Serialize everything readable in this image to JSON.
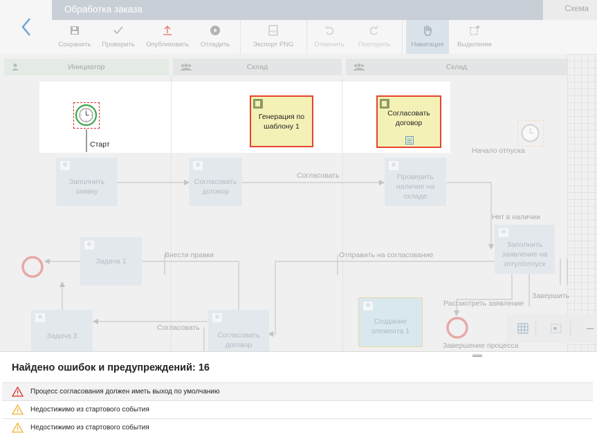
{
  "header": {
    "title": "Обработка заказа",
    "mode": "Схема"
  },
  "toolbar": {
    "save": "Сохранить",
    "check": "Проверить",
    "publish": "Опубликовать",
    "debug": "Отладить",
    "export_png": "Экспорт PNG",
    "undo": "Отменить",
    "redo": "Повторить",
    "navigation": "Навигация",
    "selection": "Выделение"
  },
  "lanes": [
    {
      "title": "Инициатор"
    },
    {
      "title": "Склад"
    },
    {
      "title": "Склад"
    }
  ],
  "diagram": {
    "start_label": "Старт",
    "task_generate": "Генерация по шаблону 1",
    "task_approve_contract": "Согласовать договор",
    "event_vacation_start": "Начало отпуска",
    "task_fill_request": "Заполнить заявку",
    "task_approve_contract_2": "Согласовать договор",
    "flow_approve": "Согласовать",
    "task_check_stock": "Проверить наличие на складе",
    "flow_not_in_stock": "Нет в наличии",
    "task_fill_vacation": "Заполнить заявление на отгул/отпуск",
    "task_1": "Задача 1",
    "flow_edit": "Внести правки",
    "flow_send_approval": "Отправить на согласование",
    "flow_review_request": "Рассмотреть заявление",
    "flow_finish": "Завершить",
    "task_3": "Задача 3",
    "flow_approve_2": "Согласовать",
    "task_approve_contract_3": "Согласовать договор",
    "task_create_element": "Создание элемента 1",
    "event_process_end": "Завершение процесса"
  },
  "errors_panel": {
    "title": "Найдено ошибок и предупреждений: 16",
    "items": [
      {
        "level": "error",
        "text": "Процесс согласования должен иметь выход по умолчанию"
      },
      {
        "level": "warning",
        "text": "Недостижимо из стартового события"
      },
      {
        "level": "warning",
        "text": "Недостижимо из стартового события"
      }
    ]
  },
  "colors": {
    "error": "#d9302c",
    "warning": "#f2b233",
    "task_fill": "#f4f1b6",
    "start_event": "#3aa64a"
  }
}
